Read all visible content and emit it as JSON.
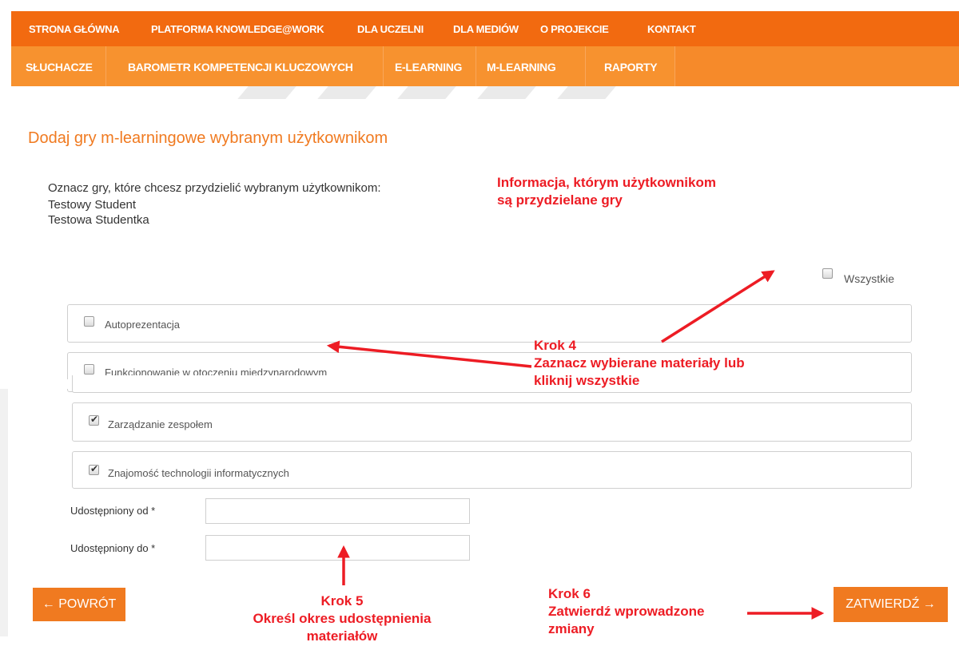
{
  "nav_top": [
    "STRONA GŁÓWNA",
    "PLATFORMA KNOWLEDGE@WORK",
    "DLA UCZELNI",
    "DLA MEDIÓW",
    "O PROJEKCIE",
    "KONTAKT"
  ],
  "nav_sub": [
    "SŁUCHACZE",
    "BAROMETR KOMPETENCJI KLUCZOWYCH",
    "E-LEARNING",
    "M-LEARNING",
    "RAPORTY"
  ],
  "page_title": "Dodaj gry m-learningowe wybranym użytkownikom",
  "intro_text": "Oznacz gry, które chcesz przydzielić wybranym użytkownikom:",
  "users": [
    "Testowy Student",
    "Testowa Studentka"
  ],
  "select_all": {
    "label": "Wszystkie",
    "checked": false
  },
  "games": [
    {
      "label": "Autoprezentacja",
      "checked": false
    },
    {
      "label": "Funkcjonowanie w otoczeniu międzynarodowym",
      "checked": false
    },
    {
      "label": "Zarządzanie zespołem",
      "checked": true
    },
    {
      "label": "Znajomość technologii informatycznych",
      "checked": true
    }
  ],
  "fields": {
    "from_label": "Udostępniony od *",
    "from_value": "",
    "to_label": "Udostępniony do *",
    "to_value": ""
  },
  "buttons": {
    "back": "← POWRÓT",
    "submit": "ZATWIERDŹ →"
  },
  "annotations": {
    "info": [
      "Informacja, którym użytkownikom",
      "są przydzielane gry"
    ],
    "step4": [
      "Krok 4",
      "Zaznacz wybierane materiały lub",
      "kliknij wszystkie"
    ],
    "step5": [
      "Krok 5",
      "Określ okres udostępnienia",
      "materiałów"
    ],
    "step6": [
      "Krok 6",
      "Zatwierdź wprowadzone",
      "zmiany"
    ]
  },
  "colors": {
    "nav_primary": "#f26a10",
    "nav_secondary": "#f68a2a",
    "accent": "#f07a20",
    "annotation_red": "#ed1c24"
  }
}
